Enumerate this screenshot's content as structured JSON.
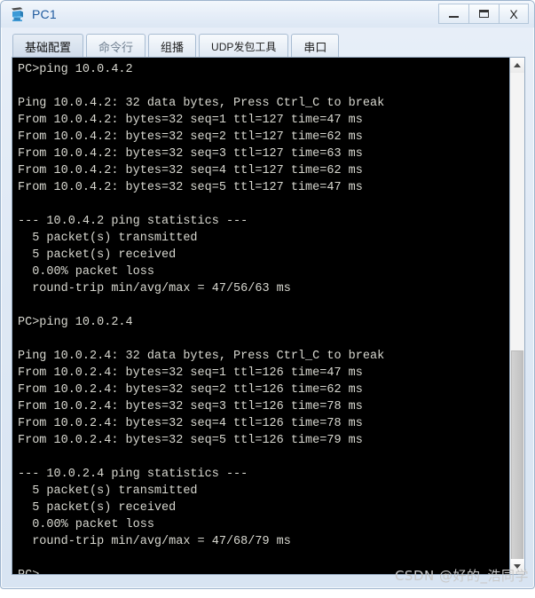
{
  "window": {
    "title": "PC1",
    "icon": "pc-device-icon",
    "controls": {
      "minimize": "—",
      "maximize": "▭",
      "close": "X"
    },
    "accent_color": "#1f5b9e",
    "frame_color": "#9db4cd"
  },
  "tabs": [
    {
      "label": "基础配置",
      "active": true
    },
    {
      "label": "命令行",
      "active": false
    },
    {
      "label": "组播",
      "active": false
    },
    {
      "label": "UDP发包工具",
      "active": false
    },
    {
      "label": "串口",
      "active": false
    }
  ],
  "terminal": {
    "background": "#000000",
    "text_color": "#d8d8d0",
    "lines": [
      "PC>ping 10.0.4.2",
      "",
      "Ping 10.0.4.2: 32 data bytes, Press Ctrl_C to break",
      "From 10.0.4.2: bytes=32 seq=1 ttl=127 time=47 ms",
      "From 10.0.4.2: bytes=32 seq=2 ttl=127 time=62 ms",
      "From 10.0.4.2: bytes=32 seq=3 ttl=127 time=63 ms",
      "From 10.0.4.2: bytes=32 seq=4 ttl=127 time=62 ms",
      "From 10.0.4.2: bytes=32 seq=5 ttl=127 time=47 ms",
      "",
      "--- 10.0.4.2 ping statistics ---",
      "  5 packet(s) transmitted",
      "  5 packet(s) received",
      "  0.00% packet loss",
      "  round-trip min/avg/max = 47/56/63 ms",
      "",
      "PC>ping 10.0.2.4",
      "",
      "Ping 10.0.2.4: 32 data bytes, Press Ctrl_C to break",
      "From 10.0.2.4: bytes=32 seq=1 ttl=126 time=47 ms",
      "From 10.0.2.4: bytes=32 seq=2 ttl=126 time=62 ms",
      "From 10.0.2.4: bytes=32 seq=3 ttl=126 time=78 ms",
      "From 10.0.2.4: bytes=32 seq=4 ttl=126 time=78 ms",
      "From 10.0.2.4: bytes=32 seq=5 ttl=126 time=79 ms",
      "",
      "--- 10.0.2.4 ping statistics ---",
      "  5 packet(s) transmitted",
      "  5 packet(s) received",
      "  0.00% packet loss",
      "  round-trip min/avg/max = 47/68/79 ms",
      "",
      "PC>"
    ]
  },
  "scrollbar": {
    "up_arrow": "▲",
    "down_arrow": "▼"
  },
  "watermark": {
    "text": "CSDN @好的_浩同学"
  }
}
